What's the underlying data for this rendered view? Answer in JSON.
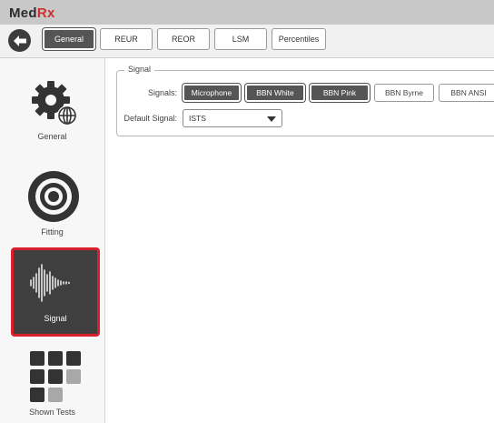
{
  "app": {
    "logo_main": "Med",
    "logo_accent": "Rx"
  },
  "toolbar": {
    "back_icon": "arrow-left-icon",
    "tabs": [
      {
        "label": "General",
        "active": true
      },
      {
        "label": "REUR",
        "active": false
      },
      {
        "label": "REOR",
        "active": false
      },
      {
        "label": "LSM",
        "active": false
      },
      {
        "label": "Percentiles",
        "active": false
      }
    ]
  },
  "sidebar": {
    "items": [
      {
        "label": "General",
        "icon": "gear-globe-icon",
        "selected": false
      },
      {
        "label": "Fitting",
        "icon": "target-icon",
        "selected": false
      },
      {
        "label": "Signal",
        "icon": "waveform-icon",
        "selected": true
      },
      {
        "label": "Shown Tests",
        "icon": "grid-icon",
        "selected": false
      }
    ]
  },
  "signal_group": {
    "title": "Signal",
    "signals_label": "Signals:",
    "signals": [
      {
        "label": "Microphone",
        "on": true
      },
      {
        "label": "BBN White",
        "on": true
      },
      {
        "label": "BBN Pink",
        "on": true
      },
      {
        "label": "BBN Byrne",
        "on": false
      },
      {
        "label": "BBN ANSI",
        "on": false
      }
    ],
    "default_label": "Default Signal:",
    "default_value": "ISTS"
  },
  "colors": {
    "titlebar": "#c8c8c8",
    "selected_dark": "#3f3f3f",
    "highlight_red": "#d81f2b",
    "logo_rx": "#cf2e2e"
  }
}
